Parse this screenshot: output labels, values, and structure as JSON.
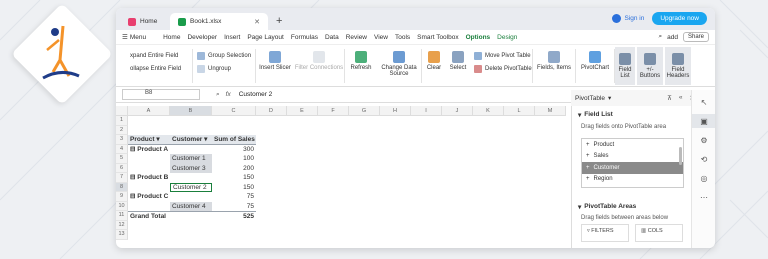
{
  "window": {
    "tabs": [
      {
        "label": "Home"
      },
      {
        "label": "Book1.xlsx"
      }
    ],
    "signin": "Sign in",
    "upgrade": "Upgrade now"
  },
  "menu": {
    "menu_label": "Menu",
    "items": [
      "Home",
      "Developer",
      "Insert",
      "Page Layout",
      "Formulas",
      "Data",
      "Review",
      "View",
      "Tools",
      "Smart Toolbox",
      "Options",
      "Design"
    ],
    "search": "add",
    "share": "Share"
  },
  "ribbon": {
    "expand": "xpand Entire Field",
    "collapse": "ollapse Entire Field",
    "group_selection": "Group Selection",
    "ungroup": "Ungroup",
    "insert_slicer": "Insert Slicer",
    "filter_connections": "Filter Connections",
    "refresh": "Refresh",
    "change_data_source_1": "Change Data",
    "change_data_source_2": "Source",
    "clear": "Clear",
    "select": "Select",
    "move_pivot": "Move Pivot Table",
    "delete_pivot": "Delete PivotTable",
    "fields_items": "Fields, Items",
    "pivotchart": "PivotChart",
    "field_list_1": "Field",
    "field_list_2": "List",
    "plus_minus_1": "+/-",
    "plus_minus_2": "Buttons",
    "field_headers_1": "Field",
    "field_headers_2": "Headers"
  },
  "formula": {
    "namebox": "B8",
    "fx": "fx",
    "value": "Customer 2"
  },
  "grid": {
    "columns": [
      "A",
      "B",
      "C",
      "D",
      "E",
      "F",
      "G",
      "H",
      "I",
      "J",
      "K",
      "L",
      "M"
    ],
    "rows": [
      "1",
      "2",
      "3",
      "4",
      "5",
      "6",
      "7",
      "8",
      "9",
      "10",
      "11",
      "12",
      "13"
    ],
    "headers": {
      "product": "Product",
      "customer": "Customer",
      "sum": "Sum of Sales"
    },
    "data": [
      {
        "row": 4,
        "a": "Product A",
        "b": "",
        "c": "300"
      },
      {
        "row": 5,
        "a": "",
        "b": "Customer 1",
        "c": "100"
      },
      {
        "row": 6,
        "a": "",
        "b": "Customer 3",
        "c": "200"
      },
      {
        "row": 7,
        "a": "Product B",
        "b": "",
        "c": "150"
      },
      {
        "row": 8,
        "a": "",
        "b": "Customer 2",
        "c": "150"
      },
      {
        "row": 9,
        "a": "Product C",
        "b": "",
        "c": "75"
      },
      {
        "row": 10,
        "a": "",
        "b": "Customer 4",
        "c": "75"
      }
    ],
    "grand_total": {
      "label": "Grand Total",
      "value": "525"
    }
  },
  "pivot_panel": {
    "title": "PivotTable",
    "field_list": "Field List",
    "drag_fields": "Drag fields onto PivotTable area",
    "fields": [
      "Product",
      "Sales",
      "Customer",
      "Region"
    ],
    "selected_field": "Customer",
    "areas_title": "PivotTable Areas",
    "drag_between": "Drag fields between areas below",
    "filters": "FILTERS",
    "cols": "COLS"
  },
  "colors": {
    "accent_green": "#1a7f3c",
    "upgrade_blue": "#1aa6f0",
    "selection_gray": "#d8dbe0"
  }
}
